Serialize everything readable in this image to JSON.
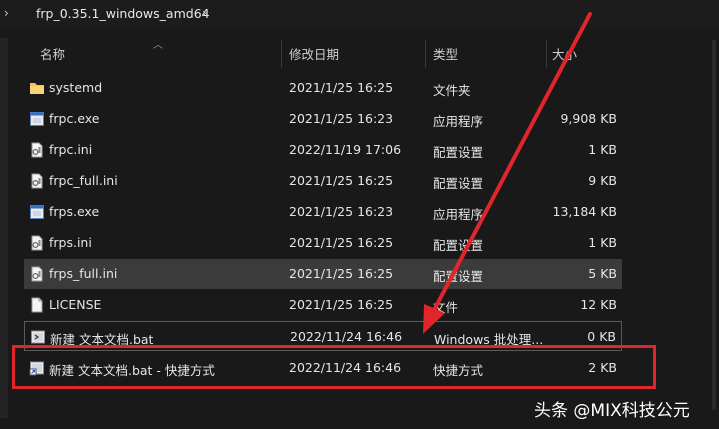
{
  "breadcrumb": {
    "folder": "frp_0.35.1_windows_amd64"
  },
  "columns": {
    "name": "名称",
    "date": "修改日期",
    "type": "类型",
    "size": "大小"
  },
  "files": [
    {
      "name": "systemd",
      "date": "2021/1/25 16:25",
      "type": "文件夹",
      "size": "",
      "icon": "folder-icon"
    },
    {
      "name": "frpc.exe",
      "date": "2021/1/25 16:23",
      "type": "应用程序",
      "size": "9,908 KB",
      "icon": "exe-icon"
    },
    {
      "name": "frpc.ini",
      "date": "2022/11/19 17:06",
      "type": "配置设置",
      "size": "1 KB",
      "icon": "ini-icon"
    },
    {
      "name": "frpc_full.ini",
      "date": "2021/1/25 16:25",
      "type": "配置设置",
      "size": "9 KB",
      "icon": "ini-icon"
    },
    {
      "name": "frps.exe",
      "date": "2021/1/25 16:23",
      "type": "应用程序",
      "size": "13,184 KB",
      "icon": "exe-icon"
    },
    {
      "name": "frps.ini",
      "date": "2021/1/25 16:25",
      "type": "配置设置",
      "size": "1 KB",
      "icon": "ini-icon"
    },
    {
      "name": "frps_full.ini",
      "date": "2021/1/25 16:25",
      "type": "配置设置",
      "size": "5 KB",
      "icon": "ini-icon"
    },
    {
      "name": "LICENSE",
      "date": "2021/1/25 16:25",
      "type": "文件",
      "size": "12 KB",
      "icon": "file-icon"
    },
    {
      "name": "新建 文本文档.bat",
      "date": "2022/11/24 16:46",
      "type": "Windows 批处理...",
      "size": "0 KB",
      "icon": "bat-icon"
    },
    {
      "name": "新建 文本文档.bat - 快捷方式",
      "date": "2022/11/24 16:46",
      "type": "快捷方式",
      "size": "2 KB",
      "icon": "shortcut-icon"
    }
  ],
  "watermark": "头条 @MIX科技公元",
  "colors": {
    "highlight": "#e0262a",
    "selected_row": "#3b3b3b",
    "background": "#191919"
  }
}
